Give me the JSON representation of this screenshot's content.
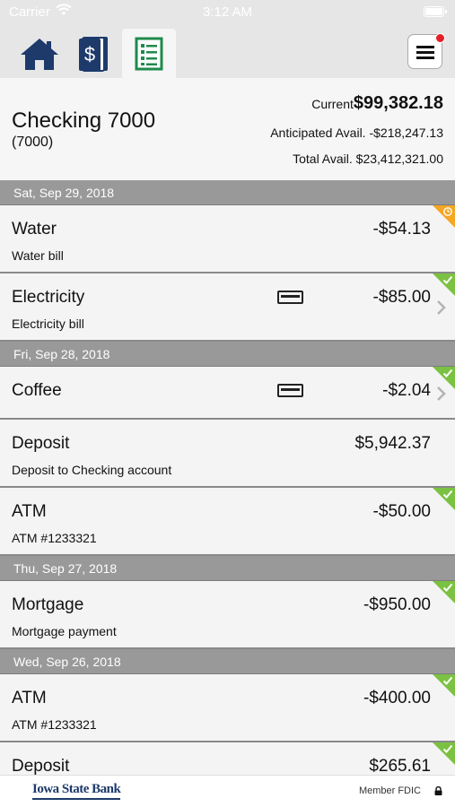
{
  "status_bar": {
    "carrier": "Carrier",
    "time": "3:12 AM"
  },
  "tabs": [
    {
      "name": "home",
      "icon": "home-icon"
    },
    {
      "name": "accounts",
      "icon": "money-stack-icon"
    },
    {
      "name": "transactions",
      "icon": "ledger-icon",
      "selected": true
    }
  ],
  "menu": {
    "icon": "hamburger-menu-icon",
    "notification_dot": true
  },
  "account": {
    "name": "Checking 7000",
    "number": "(7000)",
    "current_label": "Current",
    "current_value": "$99,382.18",
    "anticipated_label": "Anticipated Avail.",
    "anticipated_value": "-$218,247.13",
    "total_label": "Total Avail.",
    "total_value": "$23,412,321.00"
  },
  "transactions": {
    "groups": [
      {
        "date": "Sat, Sep 29, 2018",
        "items": [
          {
            "name": "Water",
            "desc": "Water bill",
            "amount": "-$54.13",
            "status": "pending"
          },
          {
            "name": "Electricity",
            "desc": "Electricity bill",
            "amount": "-$85.00",
            "status": "cleared",
            "card": true,
            "chevron": true
          }
        ]
      },
      {
        "date": "Fri, Sep 28, 2018",
        "items": [
          {
            "name": "Coffee",
            "desc": "",
            "amount": "-$2.04",
            "status": "cleared",
            "card": true,
            "chevron": true
          },
          {
            "name": "Deposit",
            "desc": "Deposit to Checking account",
            "amount": "$5,942.37",
            "status": "none"
          },
          {
            "name": "ATM",
            "desc": "ATM #1233321",
            "amount": "-$50.00",
            "status": "cleared"
          }
        ]
      },
      {
        "date": "Thu, Sep 27, 2018",
        "items": [
          {
            "name": "Mortgage",
            "desc": "Mortgage payment",
            "amount": "-$950.00",
            "status": "cleared"
          }
        ]
      },
      {
        "date": "Wed, Sep 26, 2018",
        "items": [
          {
            "name": "ATM",
            "desc": "ATM #1233321",
            "amount": "-$400.00",
            "status": "cleared"
          },
          {
            "name": "Deposit",
            "desc": "",
            "amount": "$265.61",
            "status": "cleared"
          }
        ]
      }
    ]
  },
  "footer": {
    "bank_logo": "Iowa State Bank",
    "fdic": "Member FDIC",
    "lock_icon": "lock-icon"
  },
  "colors": {
    "header_bg": "#e6e6e6",
    "date_header": "#999999",
    "cleared": "#7bc142",
    "pending": "#f5a623",
    "brand": "#1d3a6b"
  }
}
